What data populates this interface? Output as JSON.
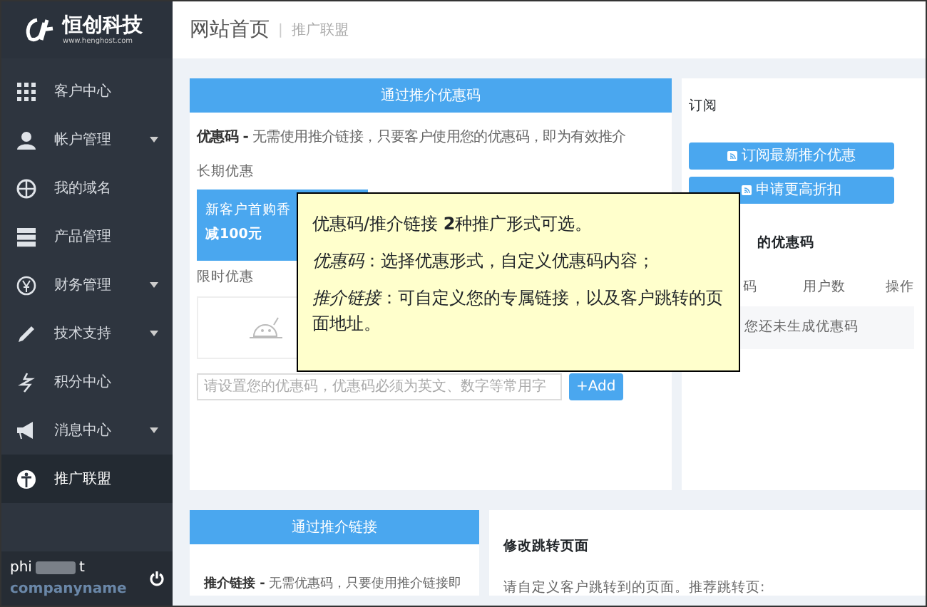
{
  "logo": {
    "name": "恒创科技",
    "url": "www.henghost.com"
  },
  "menu": [
    {
      "label": "客户中心",
      "caret": false,
      "selected": false
    },
    {
      "label": "帐户管理",
      "caret": true,
      "selected": false
    },
    {
      "label": "我的域名",
      "caret": false,
      "selected": false
    },
    {
      "label": "产品管理",
      "caret": false,
      "selected": false
    },
    {
      "label": "财务管理",
      "caret": true,
      "selected": false
    },
    {
      "label": "技术支持",
      "caret": true,
      "selected": false
    },
    {
      "label": "积分中心",
      "caret": false,
      "selected": false
    },
    {
      "label": "消息中心",
      "caret": true,
      "selected": false
    },
    {
      "label": "推广联盟",
      "caret": false,
      "selected": true
    }
  ],
  "user": {
    "name_start": "phi",
    "name_end": "t",
    "company": "companyname"
  },
  "breadcrumb": {
    "title": "网站首页",
    "separator": "|",
    "current": "推广联盟"
  },
  "coupon_card": {
    "header": "通过推介优惠码",
    "intro": "**优惠码 -** 无需使用推介链接，只要客户使用您的优惠码，即为有效推介",
    "long_term": "长期优惠",
    "coupon_line1": "新客户首购香",
    "coupon_line2": "减100元",
    "limited": "限时优惠",
    "input_placeholder": "请设置您的优惠码，优惠码必须为英文、数字等常用字",
    "add_button": "+Add"
  },
  "subscribe_card": {
    "title": "订阅",
    "buttons": [
      "订阅最新推介优惠",
      "申请更高折扣"
    ],
    "codes_title": "的优惠码",
    "columns": [
      "码",
      "用户数",
      "操作"
    ],
    "empty": "您还未生成优惠码"
  },
  "link_card": {
    "header": "通过推介链接",
    "intro": "**推介链接 -** 无需优惠码，只要使用推介链接即"
  },
  "redirect_card": {
    "title": "修改跳转页面",
    "text": "请自定义客户跳转到的页面。推荐跳转页:"
  },
  "tooltip": {
    "lines": [
      "优惠码/推介链接 **2**种推广形式可选。",
      "*优惠码*：选择优惠形式，自定义优惠码内容；",
      "*推介链接*：可自定义您的专属链接，以及客户跳转的页面地址。"
    ]
  }
}
